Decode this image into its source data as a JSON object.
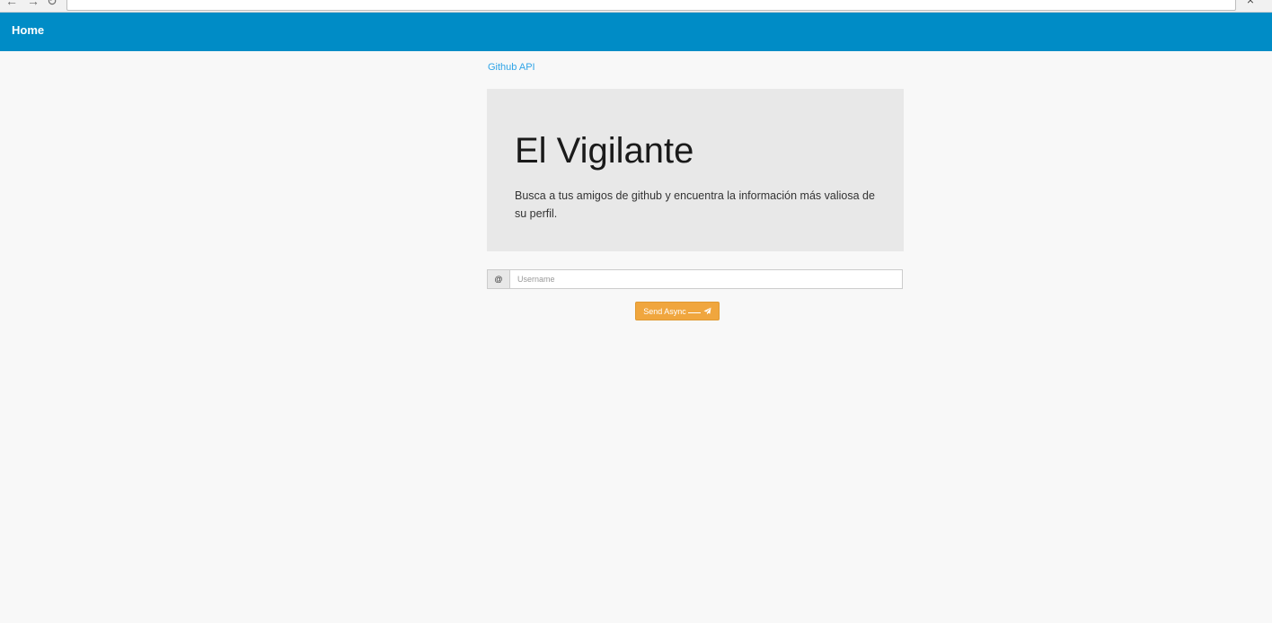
{
  "navbar": {
    "brand": "Home"
  },
  "breadcrumb": {
    "link": "Github API"
  },
  "jumbotron": {
    "title": "El Vigilante",
    "description": "Busca a tus amigos de github y encuentra la información más valiosa de su perfil."
  },
  "search": {
    "addon": "@",
    "placeholder": "Username",
    "value": ""
  },
  "send_button": {
    "label": "Send Async",
    "icon": "paper-plane-icon"
  },
  "colors": {
    "navbar": "#008cc6",
    "link": "#2fa4e7",
    "button": "#f0a63e",
    "jumbotron": "#e8e8e8",
    "page_background": "#f8f8f8"
  }
}
